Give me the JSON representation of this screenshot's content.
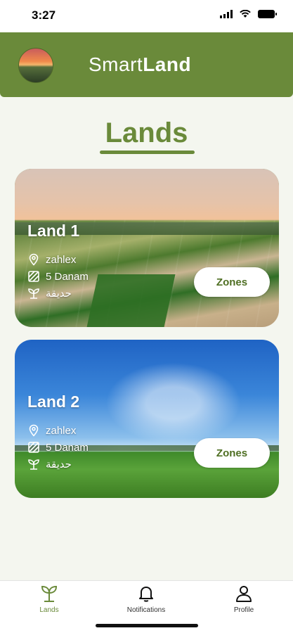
{
  "status_bar": {
    "time": "3:27"
  },
  "header": {
    "brand_light": "Smart",
    "brand_bold": "Land"
  },
  "page_title": "Lands",
  "lands": [
    {
      "name": "Land 1",
      "location": "zahlex",
      "size": "5 Danam",
      "type": "حديقة",
      "button_label": "Zones"
    },
    {
      "name": "Land 2",
      "location": "zahlex",
      "size": "5 Danam",
      "type": "حديقة",
      "button_label": "Zones"
    }
  ],
  "bottom_nav": {
    "items": [
      {
        "label": "Lands",
        "icon": "sprout-icon",
        "active": true
      },
      {
        "label": "Notifications",
        "icon": "bell-icon",
        "active": false
      },
      {
        "label": "Profile",
        "icon": "user-icon",
        "active": false
      }
    ]
  },
  "colors": {
    "brand_green": "#6a8a3a",
    "background": "#f4f6ef",
    "button_text": "#4f6f23"
  }
}
